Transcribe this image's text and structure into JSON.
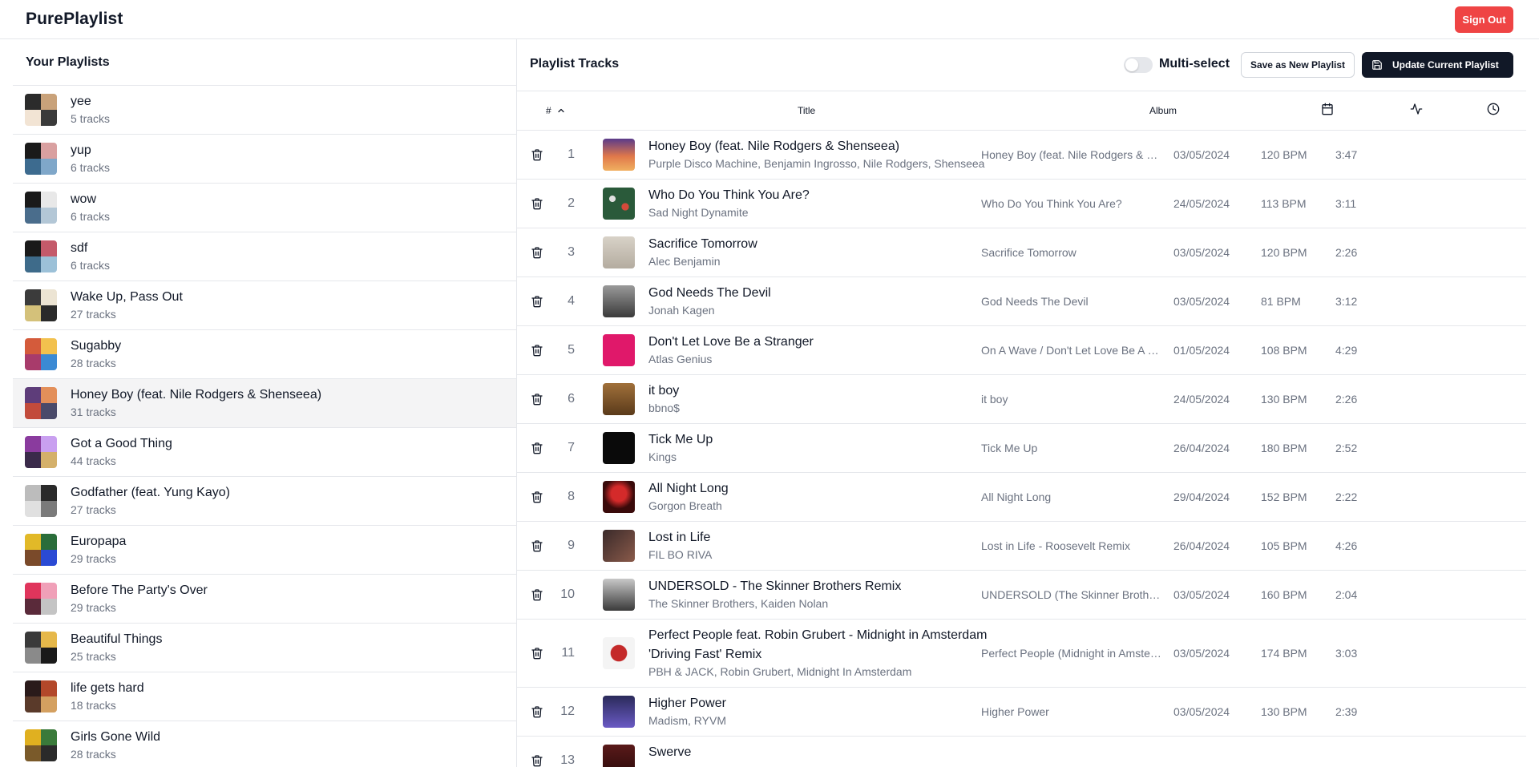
{
  "app": {
    "title": "PurePlaylist",
    "sign_out_label": "Sign Out"
  },
  "colors": {
    "accent_red": "#ef4444",
    "dark_button": "#111827",
    "active_row": "#f4f4f5"
  },
  "sidebar": {
    "title": "Your Playlists",
    "playlists": [
      {
        "name": "yee",
        "count": "5 tracks"
      },
      {
        "name": "yup",
        "count": "6 tracks"
      },
      {
        "name": "wow",
        "count": "6 tracks"
      },
      {
        "name": "sdf",
        "count": "6 tracks"
      },
      {
        "name": "Wake Up, Pass Out",
        "count": "27 tracks"
      },
      {
        "name": "Sugabby",
        "count": "28 tracks"
      },
      {
        "name": "Honey Boy (feat. Nile Rodgers & Shenseea)",
        "count": "31 tracks",
        "active": true
      },
      {
        "name": "Got a Good Thing",
        "count": "44 tracks"
      },
      {
        "name": "Godfather (feat. Yung Kayo)",
        "count": "27 tracks"
      },
      {
        "name": "Europapa",
        "count": "29 tracks"
      },
      {
        "name": "Before The Party's Over",
        "count": "29 tracks"
      },
      {
        "name": "Beautiful Things",
        "count": "25 tracks"
      },
      {
        "name": "life gets hard",
        "count": "18 tracks"
      },
      {
        "name": "Girls Gone Wild",
        "count": "28 tracks"
      }
    ]
  },
  "main": {
    "title": "Playlist Tracks",
    "multiselect_label": "Multi-select",
    "multiselect_on": false,
    "save_new_label": "Save as New Playlist",
    "update_label": "Update Current Playlist",
    "columns": {
      "num": "#",
      "title": "Title",
      "album": "Album",
      "date_icon": "calendar-icon",
      "bpm_icon": "activity-icon",
      "duration_icon": "clock-icon"
    },
    "tracks": [
      {
        "num": "1",
        "title": "Honey Boy (feat. Nile Rodgers & Shenseea)",
        "artist": "Purple Disco Machine, Benjamin Ingrosso, Nile Rodgers, Shenseea",
        "album": "Honey Boy (feat. Nile Rodgers & Shenseea)",
        "date": "03/05/2024",
        "bpm": "120 BPM",
        "duration": "3:47"
      },
      {
        "num": "2",
        "title": "Who Do You Think You Are?",
        "artist": "Sad Night Dynamite",
        "album": "Who Do You Think You Are?",
        "date": "24/05/2024",
        "bpm": "113 BPM",
        "duration": "3:11"
      },
      {
        "num": "3",
        "title": "Sacrifice Tomorrow",
        "artist": "Alec Benjamin",
        "album": "Sacrifice Tomorrow",
        "date": "03/05/2024",
        "bpm": "120 BPM",
        "duration": "2:26"
      },
      {
        "num": "4",
        "title": "God Needs The Devil",
        "artist": "Jonah Kagen",
        "album": "God Needs The Devil",
        "date": "03/05/2024",
        "bpm": "81 BPM",
        "duration": "3:12"
      },
      {
        "num": "5",
        "title": "Don't Let Love Be a Stranger",
        "artist": "Atlas Genius",
        "album": "On A Wave / Don't Let Love Be A Stranger",
        "date": "01/05/2024",
        "bpm": "108 BPM",
        "duration": "4:29"
      },
      {
        "num": "6",
        "title": "it boy",
        "artist": "bbno$",
        "album": "it boy",
        "date": "24/05/2024",
        "bpm": "130 BPM",
        "duration": "2:26"
      },
      {
        "num": "7",
        "title": "Tick Me Up",
        "artist": "Kings",
        "album": "Tick Me Up",
        "date": "26/04/2024",
        "bpm": "180 BPM",
        "duration": "2:52"
      },
      {
        "num": "8",
        "title": "All Night Long",
        "artist": "Gorgon Breath",
        "album": "All Night Long",
        "date": "29/04/2024",
        "bpm": "152 BPM",
        "duration": "2:22"
      },
      {
        "num": "9",
        "title": "Lost in Life",
        "artist": "FIL BO RIVA",
        "album": "Lost in Life - Roosevelt Remix",
        "date": "26/04/2024",
        "bpm": "105 BPM",
        "duration": "4:26"
      },
      {
        "num": "10",
        "title": "UNDERSOLD - The Skinner Brothers Remix",
        "artist": "The Skinner Brothers, Kaiden Nolan",
        "album": "UNDERSOLD (The Skinner Brothers Remix)",
        "date": "03/05/2024",
        "bpm": "160 BPM",
        "duration": "2:04"
      },
      {
        "num": "11",
        "title": "Perfect People feat. Robin Grubert - Midnight in Amsterdam 'Driving Fast' Remix",
        "artist": "PBH & JACK, Robin Grubert, Midnight In Amsterdam",
        "album": "Perfect People (Midnight in Amsterdam 'Driving Fast' Remix)",
        "date": "03/05/2024",
        "bpm": "174 BPM",
        "duration": "3:03",
        "tall": true
      },
      {
        "num": "12",
        "title": "Higher Power",
        "artist": "Madism, RYVM",
        "album": "Higher Power",
        "date": "03/05/2024",
        "bpm": "130 BPM",
        "duration": "2:39"
      },
      {
        "num": "13",
        "title": "Swerve",
        "artist": "",
        "album": "",
        "date": "",
        "bpm": "",
        "duration": ""
      }
    ]
  }
}
